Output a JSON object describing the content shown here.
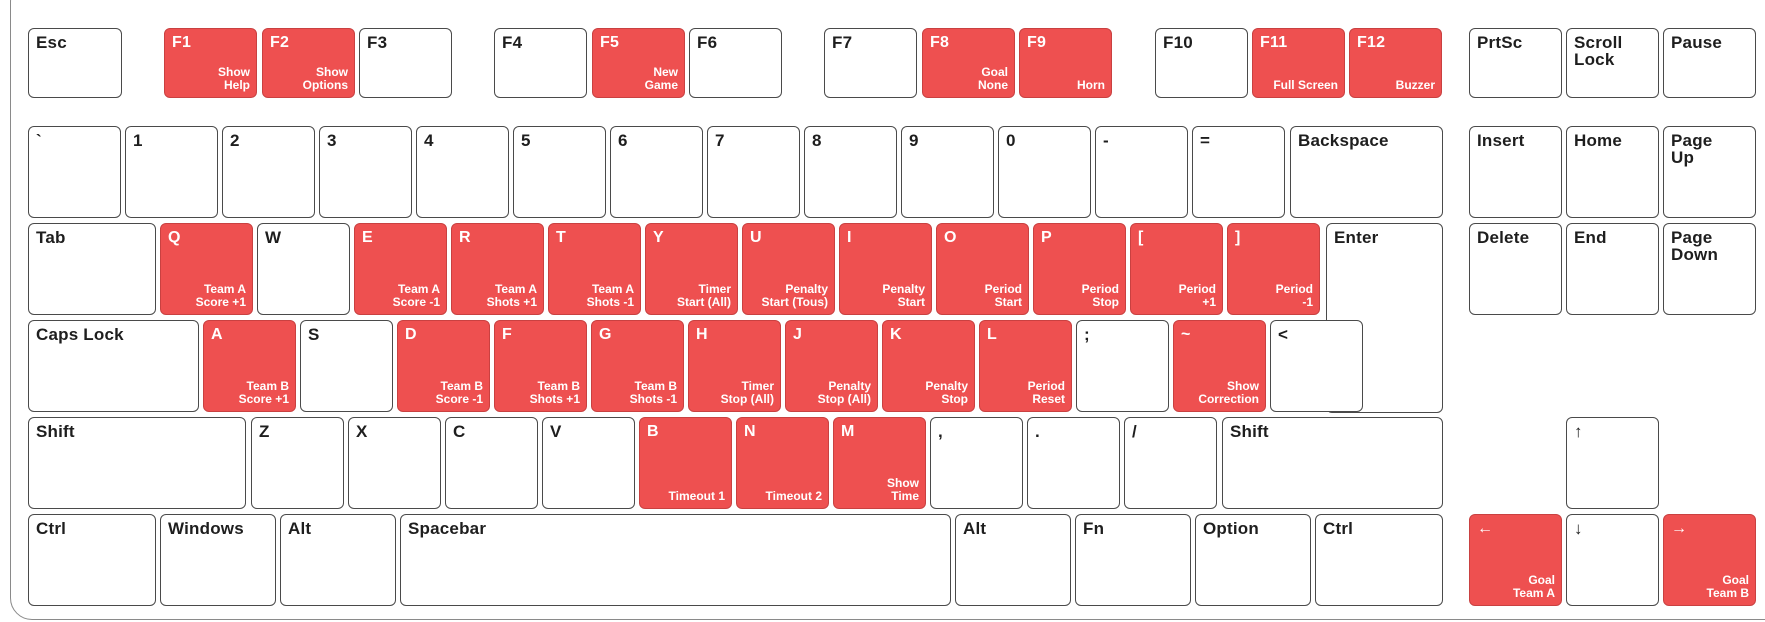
{
  "keyboard": {
    "rows": [
      {
        "keys": [
          {
            "id": "esc",
            "label": "Esc"
          },
          {
            "id": "f1",
            "label": "F1",
            "action": "Show\nHelp",
            "highlight": true
          },
          {
            "id": "f2",
            "label": "F2",
            "action": "Show\nOptions",
            "highlight": true
          },
          {
            "id": "f3",
            "label": "F3"
          },
          {
            "id": "f4",
            "label": "F4"
          },
          {
            "id": "f5",
            "label": "F5",
            "action": "New\nGame",
            "highlight": true
          },
          {
            "id": "f6",
            "label": "F6"
          },
          {
            "id": "f7",
            "label": "F7"
          },
          {
            "id": "f8",
            "label": "F8",
            "action": "Goal\nNone",
            "highlight": true
          },
          {
            "id": "f9",
            "label": "F9",
            "action": "Horn",
            "highlight": true
          },
          {
            "id": "f10",
            "label": "F10"
          },
          {
            "id": "f11",
            "label": "F11",
            "action": "Full Screen",
            "highlight": true
          },
          {
            "id": "f12",
            "label": "F12",
            "action": "Buzzer",
            "highlight": true
          },
          {
            "id": "prtsc",
            "label": "PrtSc"
          },
          {
            "id": "scroll-lock",
            "label": "Scroll\nLock"
          },
          {
            "id": "pause",
            "label": "Pause"
          }
        ]
      },
      {
        "keys": [
          {
            "id": "backtick",
            "label": "`"
          },
          {
            "id": "1",
            "label": "1"
          },
          {
            "id": "2",
            "label": "2"
          },
          {
            "id": "3",
            "label": "3"
          },
          {
            "id": "4",
            "label": "4"
          },
          {
            "id": "5",
            "label": "5"
          },
          {
            "id": "6",
            "label": "6"
          },
          {
            "id": "7",
            "label": "7"
          },
          {
            "id": "8",
            "label": "8"
          },
          {
            "id": "9",
            "label": "9"
          },
          {
            "id": "0",
            "label": "0"
          },
          {
            "id": "minus",
            "label": "-"
          },
          {
            "id": "equals",
            "label": "="
          },
          {
            "id": "backspace",
            "label": "Backspace"
          },
          {
            "id": "insert",
            "label": "Insert"
          },
          {
            "id": "home",
            "label": "Home"
          },
          {
            "id": "page-up",
            "label": "Page\nUp"
          }
        ]
      },
      {
        "keys": [
          {
            "id": "tab",
            "label": "Tab"
          },
          {
            "id": "q",
            "label": "Q",
            "action": "Team A\nScore +1",
            "highlight": true
          },
          {
            "id": "w",
            "label": "W"
          },
          {
            "id": "e",
            "label": "E",
            "action": "Team A\nScore -1",
            "highlight": true
          },
          {
            "id": "r",
            "label": "R",
            "action": "Team A\nShots +1",
            "highlight": true
          },
          {
            "id": "t",
            "label": "T",
            "action": "Team A\nShots -1",
            "highlight": true
          },
          {
            "id": "y",
            "label": "Y",
            "action": "Timer\nStart (All)",
            "highlight": true
          },
          {
            "id": "u",
            "label": "U",
            "action": "Penalty\nStart (Tous)",
            "highlight": true
          },
          {
            "id": "i",
            "label": "I",
            "action": "Penalty\nStart",
            "highlight": true
          },
          {
            "id": "o",
            "label": "O",
            "action": "Period\nStart",
            "highlight": true
          },
          {
            "id": "p",
            "label": "P",
            "action": "Period\nStop",
            "highlight": true
          },
          {
            "id": "lbracket",
            "label": "[",
            "action": "Period\n+1",
            "highlight": true
          },
          {
            "id": "rbracket",
            "label": "]",
            "action": "Period\n-1",
            "highlight": true
          },
          {
            "id": "enter",
            "label": "Enter"
          },
          {
            "id": "delete",
            "label": "Delete"
          },
          {
            "id": "end",
            "label": "End"
          },
          {
            "id": "page-down",
            "label": "Page\nDown"
          }
        ]
      },
      {
        "keys": [
          {
            "id": "caps-lock",
            "label": "Caps Lock"
          },
          {
            "id": "a",
            "label": "A",
            "action": "Team B\nScore +1",
            "highlight": true
          },
          {
            "id": "s",
            "label": "S"
          },
          {
            "id": "d",
            "label": "D",
            "action": "Team B\nScore -1",
            "highlight": true
          },
          {
            "id": "f",
            "label": "F",
            "action": "Team B\nShots +1",
            "highlight": true
          },
          {
            "id": "g",
            "label": "G",
            "action": "Team B\nShots -1",
            "highlight": true
          },
          {
            "id": "h",
            "label": "H",
            "action": "Timer\nStop (All)",
            "highlight": true
          },
          {
            "id": "j",
            "label": "J",
            "action": "Penalty\nStop (All)",
            "highlight": true
          },
          {
            "id": "k",
            "label": "K",
            "action": "Penalty\nStop",
            "highlight": true
          },
          {
            "id": "l",
            "label": "L",
            "action": "Period\nReset",
            "highlight": true
          },
          {
            "id": "semicolon",
            "label": ";"
          },
          {
            "id": "tilde",
            "label": "~",
            "action": "Show\nCorrection",
            "highlight": true
          },
          {
            "id": "less-than",
            "label": "<"
          }
        ]
      },
      {
        "keys": [
          {
            "id": "shift-left",
            "label": "Shift"
          },
          {
            "id": "z",
            "label": "Z"
          },
          {
            "id": "x",
            "label": "X"
          },
          {
            "id": "c",
            "label": "C"
          },
          {
            "id": "v",
            "label": "V"
          },
          {
            "id": "b",
            "label": "B",
            "action": "Timeout 1",
            "highlight": true
          },
          {
            "id": "n",
            "label": "N",
            "action": "Timeout 2",
            "highlight": true
          },
          {
            "id": "m",
            "label": "M",
            "action": "Show\nTime",
            "highlight": true
          },
          {
            "id": "comma",
            "label": ","
          },
          {
            "id": "period",
            "label": "."
          },
          {
            "id": "slash",
            "label": "/"
          },
          {
            "id": "shift-right",
            "label": "Shift"
          },
          {
            "id": "arrow-up",
            "label": "↑"
          }
        ]
      },
      {
        "keys": [
          {
            "id": "ctrl-left",
            "label": "Ctrl"
          },
          {
            "id": "windows",
            "label": "Windows"
          },
          {
            "id": "alt-left",
            "label": "Alt"
          },
          {
            "id": "spacebar",
            "label": "Spacebar"
          },
          {
            "id": "alt-right",
            "label": "Alt"
          },
          {
            "id": "fn",
            "label": "Fn"
          },
          {
            "id": "option",
            "label": "Option"
          },
          {
            "id": "ctrl-right",
            "label": "Ctrl"
          },
          {
            "id": "arrow-left",
            "label": "←",
            "action": "Goal\nTeam A",
            "highlight": true
          },
          {
            "id": "arrow-down",
            "label": "↓"
          },
          {
            "id": "arrow-right",
            "label": "→",
            "action": "Goal\nTeam B",
            "highlight": true
          }
        ]
      }
    ]
  }
}
